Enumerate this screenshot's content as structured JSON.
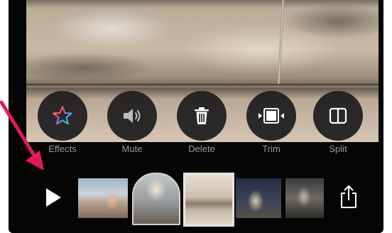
{
  "toolbar": {
    "tools": [
      {
        "label": "Effects",
        "icon": "star-icon"
      },
      {
        "label": "Mute",
        "icon": "speaker-icon"
      },
      {
        "label": "Delete",
        "icon": "trash-icon"
      },
      {
        "label": "Trim",
        "icon": "trim-icon"
      },
      {
        "label": "Split",
        "icon": "split-icon"
      }
    ]
  },
  "timeline": {
    "play_icon": "play-icon",
    "share_icon": "share-icon",
    "clips": [
      "clip-beach",
      "clip-arch",
      "clip-plaza",
      "clip-fountain",
      "clip-statue"
    ]
  },
  "annotation": {
    "color": "#e8175d",
    "icon": "arrow-icon"
  },
  "colors": {
    "background": "#050505",
    "tool_circle": "#1c1c1c",
    "tool_label": "#9a9a9a",
    "icon": "#ffffff"
  }
}
